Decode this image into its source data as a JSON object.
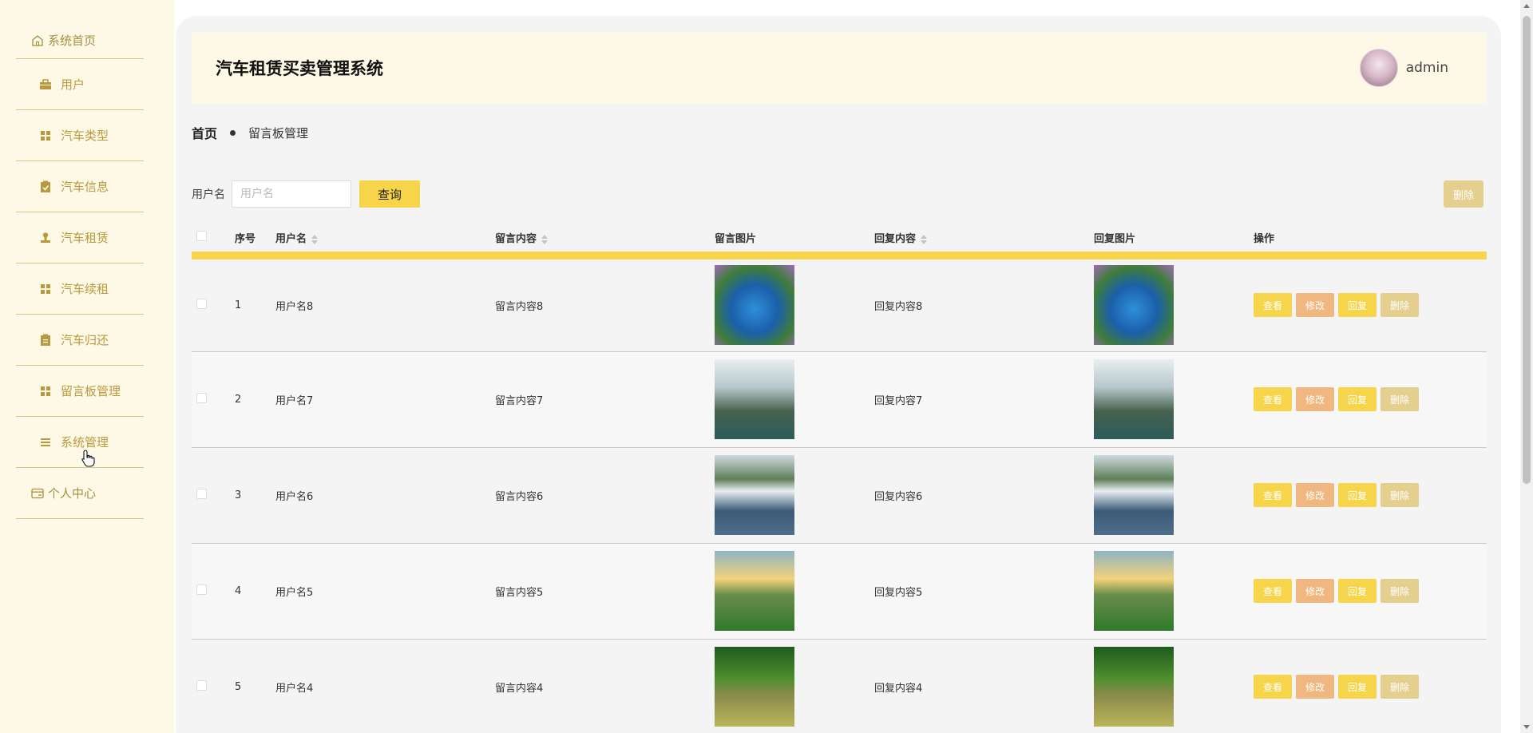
{
  "app": {
    "title": "汽车租赁买卖管理系统"
  },
  "user": {
    "name": "admin"
  },
  "sidebar": {
    "items": [
      {
        "label": "系统首页",
        "icon": "home-icon"
      },
      {
        "label": "用户",
        "icon": "briefcase-icon"
      },
      {
        "label": "汽车类型",
        "icon": "grid-icon"
      },
      {
        "label": "汽车信息",
        "icon": "clipboard-check-icon"
      },
      {
        "label": "汽车租赁",
        "icon": "stamp-icon"
      },
      {
        "label": "汽车续租",
        "icon": "grid-icon"
      },
      {
        "label": "汽车归还",
        "icon": "clipboard-icon"
      },
      {
        "label": "留言板管理",
        "icon": "grid-icon"
      },
      {
        "label": "系统管理",
        "icon": "list-icon"
      },
      {
        "label": "个人中心",
        "icon": "card-icon"
      }
    ]
  },
  "breadcrumb": {
    "home": "首页",
    "current": "留言板管理"
  },
  "search": {
    "label": "用户名",
    "placeholder": "用户名",
    "button": "查询",
    "delete_button": "删除"
  },
  "table": {
    "headers": {
      "index": "序号",
      "username": "用户名",
      "content": "留言内容",
      "image": "留言图片",
      "reply": "回复内容",
      "reply_image": "回复图片",
      "actions": "操作"
    },
    "rows": [
      {
        "index": "1",
        "username": "用户名8",
        "content": "留言内容8",
        "reply": "回复内容8"
      },
      {
        "index": "2",
        "username": "用户名7",
        "content": "留言内容7",
        "reply": "回复内容7"
      },
      {
        "index": "3",
        "username": "用户名6",
        "content": "留言内容6",
        "reply": "回复内容6"
      },
      {
        "index": "4",
        "username": "用户名5",
        "content": "留言内容5",
        "reply": "回复内容5"
      },
      {
        "index": "5",
        "username": "用户名4",
        "content": "留言内容4",
        "reply": "回复内容4"
      }
    ],
    "actions": {
      "view": "查看",
      "edit": "修改",
      "reply": "回复",
      "delete": "删除"
    }
  },
  "colors": {
    "accent": "#f6d54a",
    "sidebar_bg": "#fdf9e6",
    "menu_text": "#b89a3e"
  }
}
